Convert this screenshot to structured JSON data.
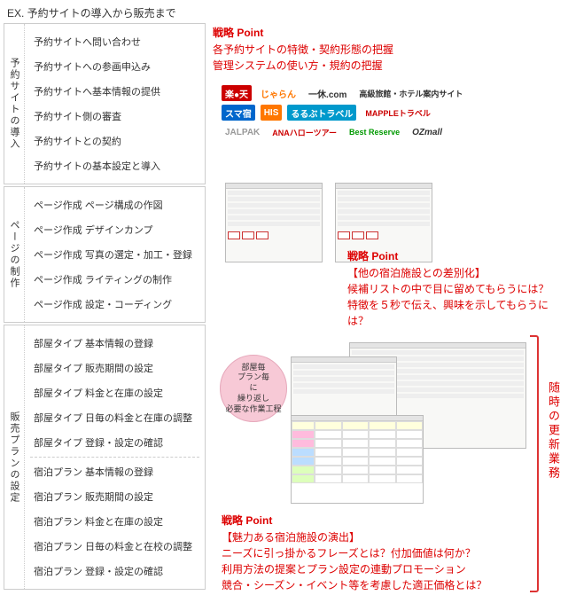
{
  "title": "EX. 予約サイトの導入から販売まで",
  "sections": [
    {
      "label": "予約サイトの導入",
      "items": [
        "予約サイトへ問い合わせ",
        "予約サイトへの参画申込み",
        "予約サイトへ基本情報の提供",
        "予約サイト側の審査",
        "予約サイトとの契約",
        "予約サイトの基本設定と導入"
      ]
    },
    {
      "label": "ページの制作",
      "items": [
        "ページ作成 ページ構成の作図",
        "ページ作成 デザインカンプ",
        "ページ作成 写真の選定・加工・登録",
        "ページ作成 ライティングの制作",
        "ページ作成 設定・コーディング"
      ]
    },
    {
      "label": "販売プランの設定",
      "groups": [
        [
          "部屋タイプ 基本情報の登録",
          "部屋タイプ 販売期間の設定",
          "部屋タイプ 料金と在庫の設定",
          "部屋タイプ 日毎の料金と在庫の調整",
          "部屋タイプ 登録・設定の確認"
        ],
        [
          "宿泊プラン 基本情報の登録",
          "宿泊プラン 販売期間の設定",
          "宿泊プラン 料金と在庫の設定",
          "宿泊プラン 日毎の料金と在校の調整",
          "宿泊プラン 登録・設定の確認"
        ]
      ]
    }
  ],
  "point1": {
    "label": "戦略 Point",
    "line1": "各予約サイトの特徴・契約形態の把握",
    "line2": "管理システムの使い方・規約の把握"
  },
  "point2": {
    "label": "戦略 Point",
    "subtitle": "【他の宿泊施設との差別化】",
    "line1": "候補リストの中で目に留めてもらうには？",
    "line2": "特徴を５秒で伝え、興味を示してもらうには？"
  },
  "point3": {
    "label": "戦略 Point",
    "subtitle": "【魅力ある宿泊施設の演出】",
    "line1": "ニーズに引っ掛かるフレーズとは？付加価値は何か？",
    "line2": "利用方法の提案とプラン設定の連動プロモーション",
    "line3": "競合・シーズン・イベント等を考慮した適正価格とは？"
  },
  "bubble": "部屋毎\nプラン毎\nに\n繰り返し\n必要な作業工程",
  "right_vertical": "随時の更新業務",
  "logos": {
    "row1": [
      "楽●天",
      "じゃらん",
      "一休.com",
      "高級旅館・ホテル案内サイト"
    ],
    "row2": [
      "スマ宿",
      "HIS",
      "るるぶトラベル",
      "MAPPLEトラベル"
    ],
    "row3": [
      "JALPAK",
      "ANAハローツアー",
      "Best Reserve",
      "OZmall"
    ]
  }
}
